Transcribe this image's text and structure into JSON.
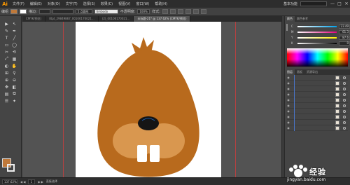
{
  "app": {
    "logo": "Ai",
    "menus": [
      "文件(F)",
      "编辑(E)",
      "对象(O)",
      "文字(T)",
      "选择(S)",
      "效果(C)",
      "视图(V)",
      "窗口(W)",
      "帮助(H)"
    ],
    "workspace": "基本功能",
    "window_controls": [
      "—",
      "□",
      "✕"
    ]
  },
  "control_bar": {
    "selection_label": "编组",
    "stroke_label": "描边:",
    "stroke_value": "",
    "brush_label": "5 点圆形",
    "profile_label": "Embodo",
    "opacity_label": "不透明度:",
    "opacity_value": "100%",
    "style_label": "样式:"
  },
  "tabs": [
    {
      "label": "CMYK/预览)",
      "active": false
    },
    {
      "label": "8tpt_29849867_00106170021…",
      "active": false
    },
    {
      "label": "(2)_00106170021…",
      "active": false
    },
    {
      "label": "未标题-21* @ 137.62% (CMYK/预览)",
      "active": true
    }
  ],
  "tools": [
    "▶",
    "↖",
    "✎",
    "✒",
    "T",
    "╱",
    "▭",
    "◯",
    "✂",
    "⟲",
    "⤢",
    "▦",
    "◐",
    "✋",
    "⊞",
    "⚲",
    "⊕",
    "⊖",
    "✥",
    "◧",
    "▤",
    "⧉",
    "☰",
    "✦"
  ],
  "colors": {
    "fill": "#c0793a",
    "fur": "#b86a1d",
    "muzzle": "#d9974f",
    "nose": "#151515",
    "teeth": "#ffffff"
  },
  "color_panel": {
    "tabs": [
      "颜色",
      "颜色参考"
    ],
    "sliders": [
      {
        "label": "C",
        "value": "23.49",
        "gradient": "linear-gradient(to right,#ffffff,#00a0e9)"
      },
      {
        "label": "M",
        "value": "61.3",
        "gradient": "linear-gradient(to right,#ffffff,#e4007f)"
      },
      {
        "label": "Y",
        "value": "87.6",
        "gradient": "linear-gradient(to right,#ffffff,#fff100)"
      },
      {
        "label": "K",
        "value": "0",
        "gradient": "linear-gradient(to right,#ffffff,#000000)"
      }
    ]
  },
  "layers_panel": {
    "tabs": [
      "图层",
      "画板",
      "资源导出"
    ],
    "row_count": 10
  },
  "status": {
    "zoom": "137.62%",
    "page": "1",
    "tool": "直接选择"
  },
  "watermark": {
    "text": "经验",
    "url": "jingyan.baidu.com"
  }
}
